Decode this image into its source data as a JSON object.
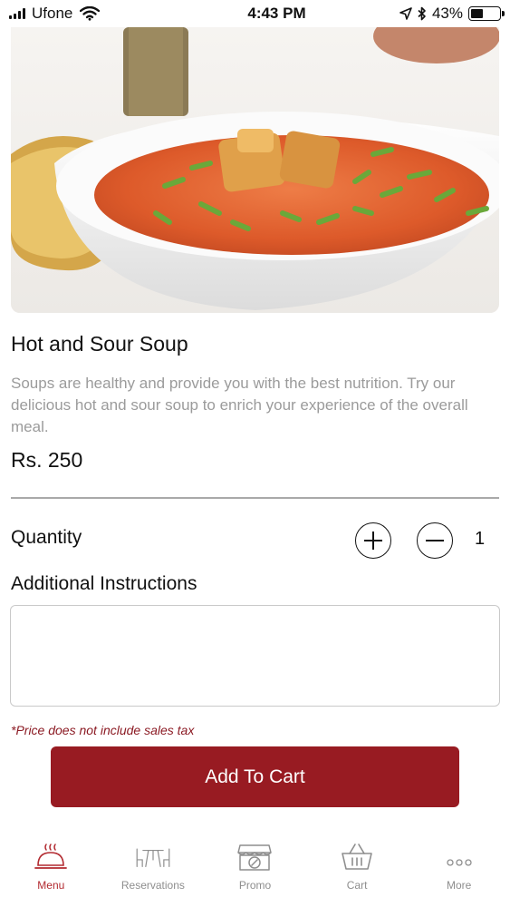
{
  "status_bar": {
    "carrier": "Ufone",
    "time": "4:43 PM",
    "battery": "43%",
    "battery_level": 0.43
  },
  "product": {
    "name": "Hot and Sour Soup",
    "description": "Soups are healthy and provide you with the best nutrition. Try our delicious hot and sour soup to enrich your experience of the overall meal.",
    "price": "Rs. 250"
  },
  "quantity": {
    "label": "Quantity",
    "value": "1"
  },
  "instructions": {
    "label": "Additional Instructions",
    "value": "",
    "placeholder": ""
  },
  "tax_note": "*Price does not include sales tax",
  "add_to_cart_label": "Add To Cart",
  "colors": {
    "accent": "#981b22",
    "active_tab": "#b22a30",
    "inactive_tab": "#8e8e8e",
    "muted_text": "#9b9b9b"
  },
  "tabbar": {
    "items": [
      {
        "label": "Menu",
        "icon": "cloche-icon",
        "active": true
      },
      {
        "label": "Reservations",
        "icon": "table-chairs-icon",
        "active": false
      },
      {
        "label": "Promo",
        "icon": "promo-store-icon",
        "active": false
      },
      {
        "label": "Cart",
        "icon": "basket-icon",
        "active": false
      },
      {
        "label": "More",
        "icon": "more-dots-icon",
        "active": false
      }
    ]
  }
}
